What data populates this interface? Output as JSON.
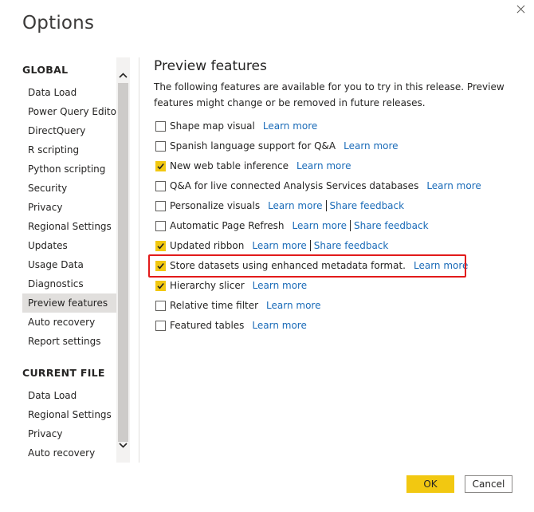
{
  "dialog": {
    "title": "Options",
    "close_icon": "close-icon"
  },
  "sidebar": {
    "global_header": "GLOBAL",
    "global_items": [
      {
        "label": "Data Load"
      },
      {
        "label": "Power Query Editor"
      },
      {
        "label": "DirectQuery"
      },
      {
        "label": "R scripting"
      },
      {
        "label": "Python scripting"
      },
      {
        "label": "Security"
      },
      {
        "label": "Privacy"
      },
      {
        "label": "Regional Settings"
      },
      {
        "label": "Updates"
      },
      {
        "label": "Usage Data"
      },
      {
        "label": "Diagnostics"
      },
      {
        "label": "Preview features",
        "selected": true
      },
      {
        "label": "Auto recovery"
      },
      {
        "label": "Report settings"
      }
    ],
    "current_file_header": "CURRENT FILE",
    "current_file_items": [
      {
        "label": "Data Load"
      },
      {
        "label": "Regional Settings"
      },
      {
        "label": "Privacy"
      },
      {
        "label": "Auto recovery"
      }
    ],
    "scroll_up_icon": "chevron-up-icon",
    "scroll_down_icon": "chevron-down-icon"
  },
  "content": {
    "title": "Preview features",
    "description": "The following features are available for you to try in this release. Preview features might change or be removed in future releases.",
    "features": [
      {
        "label": "Shape map visual",
        "checked": false,
        "links": [
          "Learn more"
        ]
      },
      {
        "label": "Spanish language support for Q&A",
        "checked": false,
        "links": [
          "Learn more"
        ]
      },
      {
        "label": "New web table inference",
        "checked": true,
        "links": [
          "Learn more"
        ]
      },
      {
        "label": "Q&A for live connected Analysis Services databases",
        "checked": false,
        "links": [
          "Learn more"
        ]
      },
      {
        "label": "Personalize visuals",
        "checked": false,
        "links": [
          "Learn more",
          "Share feedback"
        ]
      },
      {
        "label": "Automatic Page Refresh",
        "checked": false,
        "links": [
          "Learn more",
          "Share feedback"
        ]
      },
      {
        "label": "Updated ribbon",
        "checked": true,
        "links": [
          "Learn more",
          "Share feedback"
        ]
      },
      {
        "label": "Store datasets using enhanced metadata format.",
        "checked": true,
        "links": [
          "Learn more"
        ],
        "highlighted": true
      },
      {
        "label": "Hierarchy slicer",
        "checked": true,
        "links": [
          "Learn more"
        ]
      },
      {
        "label": "Relative time filter",
        "checked": false,
        "links": [
          "Learn more"
        ]
      },
      {
        "label": "Featured tables",
        "checked": false,
        "links": [
          "Learn more"
        ]
      }
    ],
    "highlight_color": "#e21b1b",
    "check_color": "#f2c811",
    "link_color": "#1a6bb8"
  },
  "footer": {
    "ok_label": "OK",
    "cancel_label": "Cancel",
    "ok_color": "#f2c811"
  }
}
